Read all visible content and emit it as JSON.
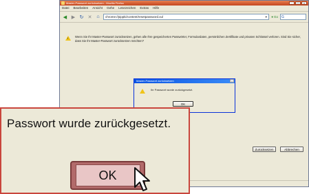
{
  "window": {
    "title": "Master-Passwort zurücksetzen - Mozilla Firefox",
    "controls": [
      "_",
      "□",
      "×"
    ]
  },
  "menu": [
    "Datei",
    "Bearbeiten",
    "Ansicht",
    "Gehe",
    "Lesezeichen",
    "Extras",
    "Hilfe"
  ],
  "toolbar": {
    "url": "chrome://pippki/content/resetpassword.xul",
    "go_label": "Go",
    "search_placeholder": "G"
  },
  "content": {
    "warning_text": "Wenn Sie Ihr Master-Passwort zurücksetzen, gehen alle Ihre gespeicherten Passwörter, Formulardaten, persönlichen Zertifikate und privaten Schlüssel verloren. Sind Sie sicher, dass Sie Ihr Master-Passwort zurücksetzen möchten?",
    "reset_button": "Zurücksetzen",
    "cancel_button": "Abbrechen"
  },
  "small_dialog": {
    "title": "Master-Passwort zurücksetzen",
    "message": "Ihr Passwort wurde zurückgesetzt.",
    "ok_label": "OK"
  },
  "zoom": {
    "message": "Passwort wurde zurückgesetzt.",
    "ok_label": "OK"
  },
  "colors": {
    "callout_border": "#c9453c",
    "titlebar": "#c4451f"
  }
}
